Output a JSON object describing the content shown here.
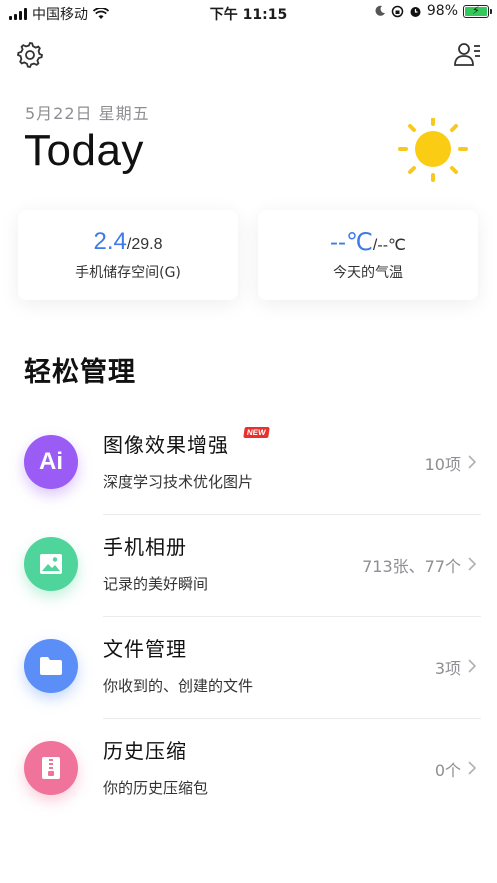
{
  "status_bar": {
    "carrier": "中国移动",
    "time": "下午 11:15",
    "battery_percent": "98%"
  },
  "header": {
    "date": "5月22日  星期五",
    "title": "Today",
    "weather_icon": "sun-icon"
  },
  "stats": {
    "storage": {
      "used": "2.4",
      "total": "/29.8",
      "label": "手机储存空间(G)"
    },
    "temperature": {
      "current": "--℃",
      "range": "/--℃",
      "label": "今天的气温"
    }
  },
  "section_title": "轻松管理",
  "items": [
    {
      "title": "图像效果增强",
      "badge": "NEW",
      "subtitle": "深度学习技术优化图片",
      "count": "10项",
      "icon": "ai-icon",
      "color": "#9b5cf6"
    },
    {
      "title": "手机相册",
      "subtitle": "记录的美好瞬间",
      "count": "713张、77个",
      "icon": "image-icon",
      "color": "#4fd59c"
    },
    {
      "title": "文件管理",
      "subtitle": "你收到的、创建的文件",
      "count": "3项",
      "icon": "folder-icon",
      "color": "#5b8ff7"
    },
    {
      "title": "历史压缩",
      "subtitle": "你的历史压缩包",
      "count": "0个",
      "icon": "zip-icon",
      "color": "#f0739c"
    }
  ],
  "ai_glyph": "Ai"
}
